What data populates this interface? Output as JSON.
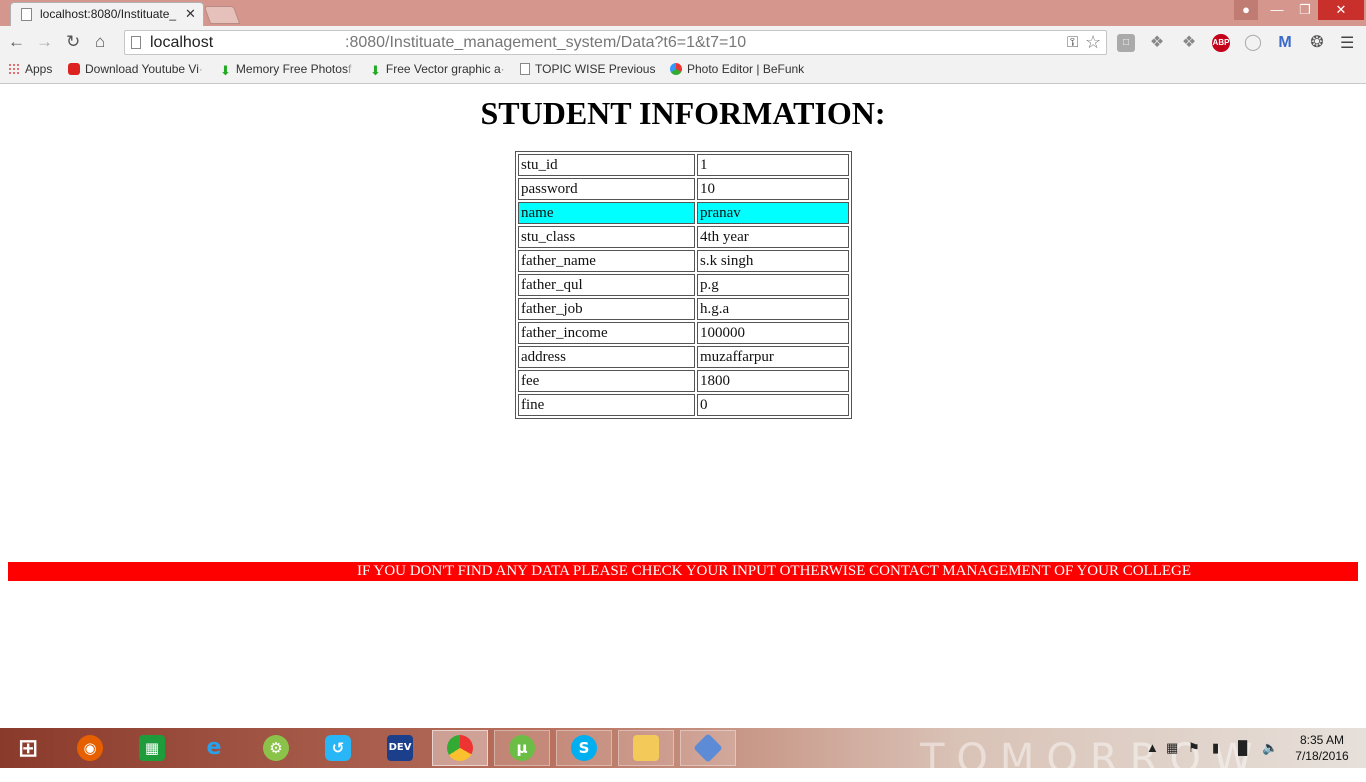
{
  "browser": {
    "tab_title": "localhost:8080/Instituate_",
    "tab_close": "✕",
    "url_host": "localhost",
    "url_path": ":8080/Instituate_management_system/Data?t6=1&t7=10",
    "ext_abp": "ABP",
    "ext_gmail": "M"
  },
  "bookmarks": [
    {
      "label": "Apps"
    },
    {
      "label": "Download Youtube Vi",
      "fade": "·"
    },
    {
      "label": "Memory Free Photos",
      "fade": "f"
    },
    {
      "label": "Free Vector graphic a",
      "fade": "·"
    },
    {
      "label": "TOPIC WISE Previous",
      "fade": ""
    },
    {
      "label": "Photo Editor | BeFunk",
      "fade": ""
    }
  ],
  "page": {
    "heading": "STUDENT INFORMATION:",
    "rows": [
      {
        "field": "stu_id",
        "value": "1"
      },
      {
        "field": "password",
        "value": "10"
      },
      {
        "field": "name",
        "value": "pranav"
      },
      {
        "field": "stu_class",
        "value": "4th year"
      },
      {
        "field": "father_name",
        "value": "s.k singh"
      },
      {
        "field": "father_qul",
        "value": "p.g"
      },
      {
        "field": "father_job",
        "value": "h.g.a"
      },
      {
        "field": "father_income",
        "value": "100000"
      },
      {
        "field": "address",
        "value": "muzaffarpur"
      },
      {
        "field": "fee",
        "value": "1800"
      },
      {
        "field": "fine",
        "value": "0"
      }
    ],
    "highlight_color": "#00ffff",
    "notice": "IF YOU DON'T FIND ANY DATA PLEASE CHECK YOUR INPUT OTHERWISE CONTACT MANAGEMENT OF YOUR COLLEGE",
    "notice_bg": "#ff0000"
  },
  "taskbar": {
    "apps": [
      "firefox",
      "store",
      "internet-explorer",
      "android-studio",
      "share",
      "dev-cpp",
      "chrome",
      "utorrent",
      "skype",
      "file-explorer",
      "virtualbox"
    ],
    "dev_label": "DEV",
    "deco_text": "TOMORROW",
    "clock_time": "8:35 AM",
    "clock_date": "7/18/2016"
  }
}
